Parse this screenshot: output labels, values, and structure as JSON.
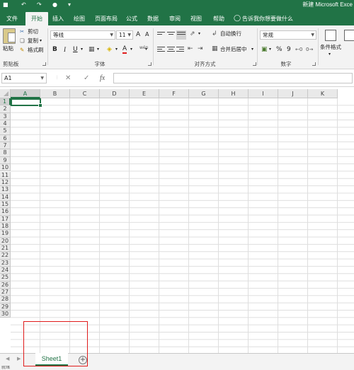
{
  "titlebar": {
    "title": "新建 Microsoft Exce",
    "qat": [
      "save-icon",
      "undo-icon",
      "redo-icon",
      "touch-mode-icon",
      "customize-icon"
    ]
  },
  "tabs": [
    {
      "label": "文件",
      "active": false
    },
    {
      "label": "开始",
      "active": true
    },
    {
      "label": "插入",
      "active": false
    },
    {
      "label": "绘图",
      "active": false
    },
    {
      "label": "页面布局",
      "active": false
    },
    {
      "label": "公式",
      "active": false
    },
    {
      "label": "数据",
      "active": false
    },
    {
      "label": "审阅",
      "active": false
    },
    {
      "label": "视图",
      "active": false
    },
    {
      "label": "帮助",
      "active": false
    }
  ],
  "tell_me": "告诉我你想要做什么",
  "ribbon": {
    "clipboard": {
      "paste": "粘贴",
      "cut": "剪切",
      "copy": "复制",
      "format_painter": "格式刷",
      "label": "剪贴板"
    },
    "font": {
      "font_name": "等线",
      "font_size": "11",
      "grow": "A",
      "shrink": "A",
      "bold": "B",
      "italic": "I",
      "underline": "U",
      "font_color_glyph": "A",
      "phonetic": "wén",
      "label": "字体"
    },
    "alignment": {
      "wrap_text": "自动换行",
      "merge_center": "合并后居中",
      "label": "对齐方式"
    },
    "number": {
      "format": "常规",
      "percent": "%",
      "comma": "9",
      "label": "数字"
    },
    "styles": {
      "conditional": "条件格式"
    }
  },
  "formula_bar": {
    "name_box": "A1",
    "cancel_glyph": "✕",
    "enter_glyph": "✓",
    "fx": "fx",
    "value": ""
  },
  "grid": {
    "columns": [
      "A",
      "B",
      "C",
      "D",
      "E",
      "F",
      "G",
      "H",
      "I",
      "J",
      "K"
    ],
    "rows": [
      "1",
      "2",
      "3",
      "4",
      "5",
      "6",
      "7",
      "8",
      "9",
      "10",
      "11",
      "12",
      "13",
      "14",
      "15",
      "16",
      "17",
      "18",
      "19",
      "20",
      "21",
      "22",
      "23",
      "24",
      "25",
      "26",
      "27",
      "28",
      "29",
      "30"
    ],
    "selected_cell": "A1"
  },
  "sheets": [
    {
      "name": "Sheet1",
      "active": true
    }
  ],
  "add_sheet_glyph": "+",
  "status": "就绪",
  "colors": {
    "accent": "#217346",
    "highlight": "#e01b1b"
  }
}
